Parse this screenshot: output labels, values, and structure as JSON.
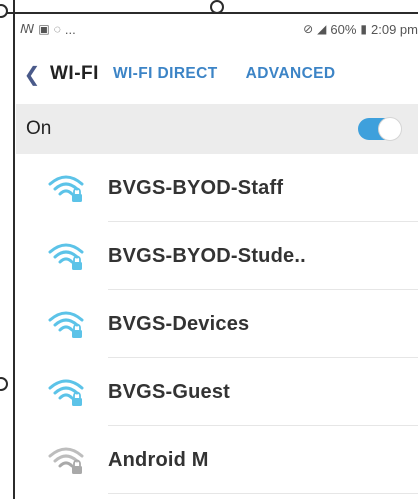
{
  "status_bar": {
    "left_icons": [
      "notification-icon",
      "gallery-icon",
      "chat-icon"
    ],
    "left_ellipsis": "...",
    "battery_percent": "60%",
    "time": "2:09 pm"
  },
  "header": {
    "title": "WI-FI",
    "tabs": [
      {
        "label": "WI-FI DIRECT"
      },
      {
        "label": "ADVANCED"
      }
    ]
  },
  "wifi_toggle": {
    "label": "On",
    "state": "on",
    "accent_color": "#3ea0dc"
  },
  "networks": [
    {
      "name": "BVGS-BYOD-Staff",
      "secured": true,
      "signal": "strong"
    },
    {
      "name": "BVGS-BYOD-Stude..",
      "secured": true,
      "signal": "strong"
    },
    {
      "name": "BVGS-Devices",
      "secured": true,
      "signal": "strong"
    },
    {
      "name": "BVGS-Guest",
      "secured": true,
      "signal": "strong"
    },
    {
      "name": "Android M",
      "secured": true,
      "signal": "weak"
    }
  ],
  "colors": {
    "accent": "#3c84c6",
    "wifi_strong": "#5cc3e8",
    "wifi_weak": "#a9a9a9"
  }
}
